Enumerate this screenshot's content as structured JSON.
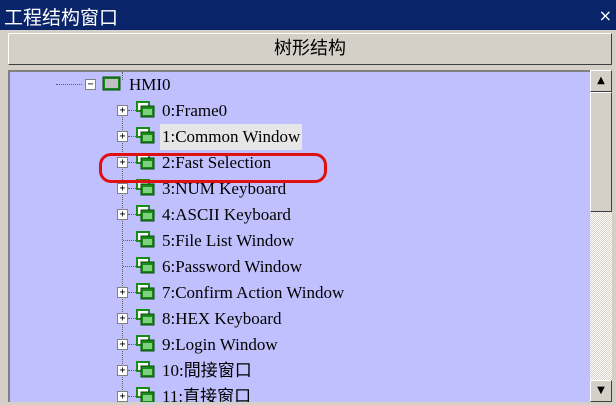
{
  "window": {
    "title": "工程结构窗口",
    "close_glyph": "×"
  },
  "header": {
    "label": "树形结构"
  },
  "tree": {
    "root": {
      "label": "HMI0",
      "expander": "−"
    },
    "items": [
      {
        "label": "0:Frame0",
        "expander": "+"
      },
      {
        "label": "1:Common Window",
        "expander": "+"
      },
      {
        "label": "2:Fast Selection",
        "expander": "+"
      },
      {
        "label": "3:NUM Keyboard",
        "expander": "+"
      },
      {
        "label": "4:ASCII Keyboard",
        "expander": "+"
      },
      {
        "label": "5:File List Window",
        "expander": ""
      },
      {
        "label": "6:Password Window",
        "expander": ""
      },
      {
        "label": "7:Confirm Action Window",
        "expander": "+"
      },
      {
        "label": "8:HEX Keyboard",
        "expander": "+"
      },
      {
        "label": "9:Login Window",
        "expander": "+"
      },
      {
        "label": "10:間接窗口",
        "expander": "+"
      },
      {
        "label": "11:直接窗口",
        "expander": "+"
      }
    ]
  },
  "scrollbar": {
    "up_glyph": "▲",
    "down_glyph": "▼"
  },
  "colors": {
    "tree_bg": "#c0c0ff",
    "highlight": "#e01010",
    "icon_green": "#1a8a1a",
    "title_bg": "#0a246a"
  }
}
